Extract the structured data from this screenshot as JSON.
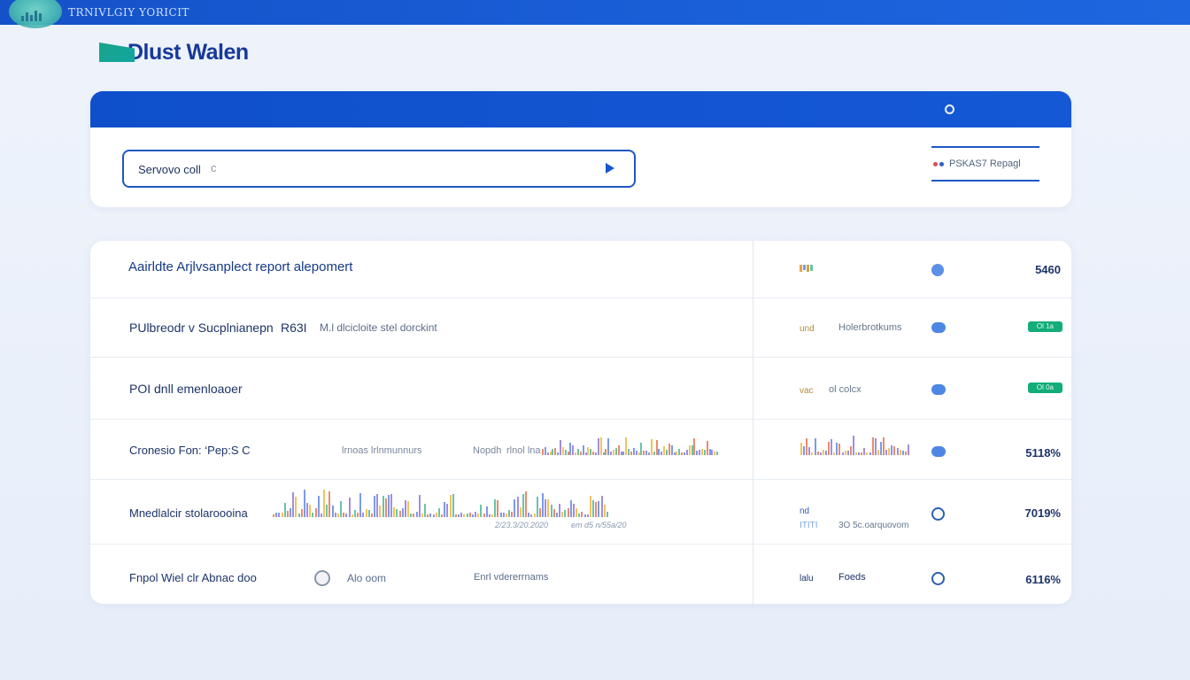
{
  "topbar": {
    "title": "TRNIVLGIY YORICIT"
  },
  "brand": {
    "name": "Dlust Walen"
  },
  "search": {
    "placeholder": "Servovo coll",
    "cursor_hint": "c",
    "filter_label": "PSKAS7 Repagl"
  },
  "rows": [
    {
      "title": "Aairldte Arjlvsanplect report alepomert",
      "value": "5460"
    },
    {
      "title": "PUlbreodr v Sucplnianepn",
      "code": "R63I",
      "subtitle": "M.l dlcicloite stel dorckint",
      "tag": "und",
      "right_label": "Holerbrotkums",
      "badge": "Ol 1a"
    },
    {
      "title": "POI dnll emenloaoer",
      "tag": "vac",
      "right_label": "ol colcx",
      "badge": "Ol 0a"
    },
    {
      "title": "Cronesio Fon: ‘Pep:S C",
      "chart_labels": [
        "lrnoas lrlnmunnurs",
        "Nopdh",
        "rlnol lna"
      ],
      "value": "5118%"
    },
    {
      "title": "Mnedlalcir stolaroooina",
      "axis_labels": [
        "2/23.3/20.2020",
        "em d5 n/55a/20"
      ],
      "tag": "nd",
      "tag2": "ITITI",
      "right_label": "3O 5c.oarquovom",
      "value": "7019%"
    },
    {
      "title": "Fnpol Wiel clr Abnac  doo",
      "meta1": "Alo oom",
      "meta2": "Enrl vdererrnams",
      "tag": "lalu",
      "right_label": "Foeds",
      "value": "6116%"
    }
  ],
  "colors": {
    "primary": "#1552c9",
    "accent_green": "#12ad78",
    "chart": [
      "#e98b6d",
      "#7a9be8",
      "#a48cdf",
      "#f2c35b",
      "#6cc3a6"
    ]
  }
}
